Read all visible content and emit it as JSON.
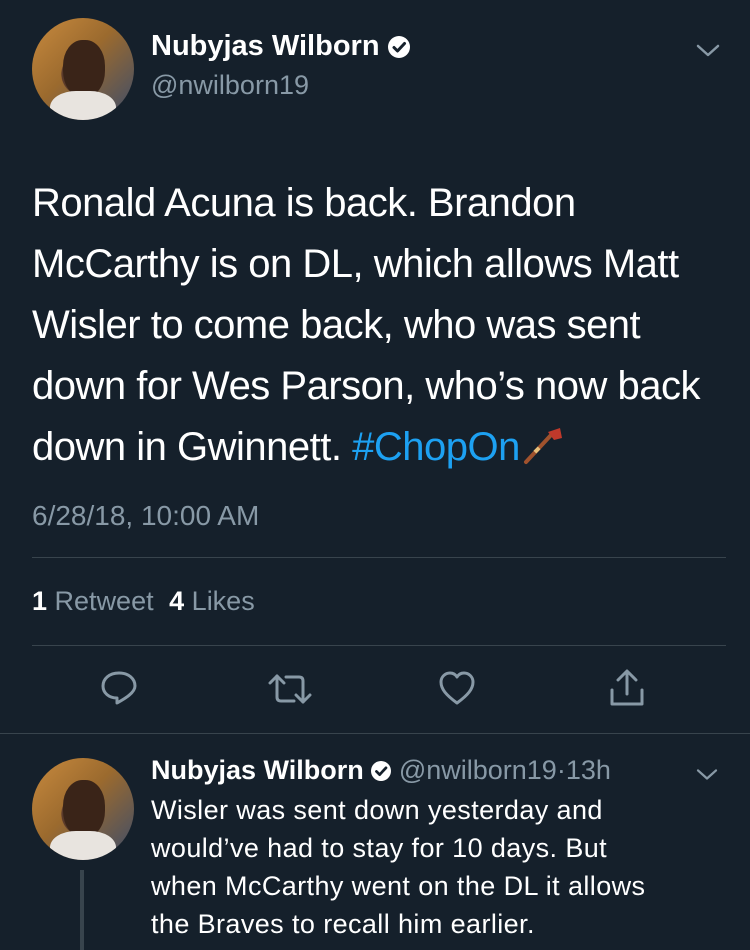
{
  "tweet": {
    "author_name": "Nubyjas Wilborn",
    "author_handle": "@nwilborn19",
    "text": "Ronald Acuna is back. Brandon McCarthy is on DL, which allows Matt Wisler to come back, who was sent down for Wes Parson, who’s now back down in Gwinnett.",
    "text_lines": [
      "Ronald Acuna is back. Brandon",
      "McCarthy is on DL, which allows Matt",
      "Wisler to come back, who was sent",
      "down for Wes Parson, who’s now back",
      "down in Gwinnett."
    ],
    "hashtag": "#ChopOn",
    "timestamp": "6/28/18, 10:00 AM",
    "retweet_count": "1",
    "retweet_label": "Retweet",
    "like_count": "4",
    "like_label": "Likes"
  },
  "actions": [
    "reply-icon",
    "retweet-icon",
    "like-icon",
    "share-icon"
  ],
  "reply": {
    "author_name": "Nubyjas Wilborn",
    "author_handle": "@nwilborn19",
    "separator": "·",
    "time_ago": "13h",
    "text_lines": [
      "Wisler was sent down yesterday and",
      "would’ve had to stay for 10 days. But",
      "when McCarthy went on the DL it allows",
      "the Braves to recall him earlier."
    ]
  },
  "colors": {
    "background": "#15202b",
    "accent": "#1da1f2",
    "secondary_text": "#8899a6",
    "divider": "#38444d"
  }
}
